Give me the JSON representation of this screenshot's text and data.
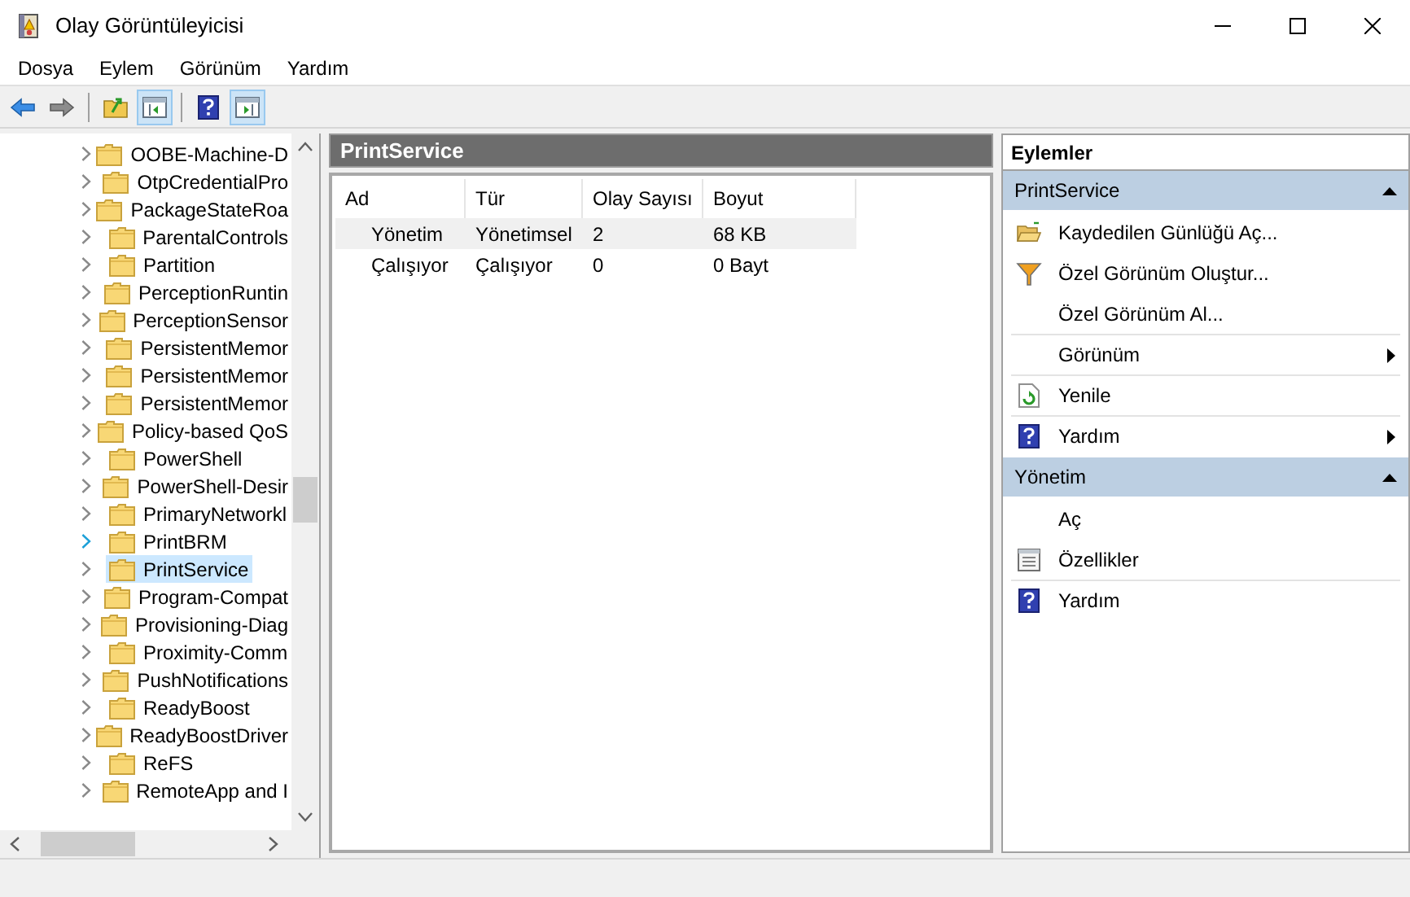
{
  "window": {
    "title": "Olay Görüntüleyicisi"
  },
  "menu": [
    "Dosya",
    "Eylem",
    "Görünüm",
    "Yardım"
  ],
  "toolbar": [
    {
      "kind": "back",
      "pressed": false
    },
    {
      "kind": "forward",
      "pressed": false
    },
    {
      "kind": "separator"
    },
    {
      "kind": "up",
      "pressed": false
    },
    {
      "kind": "console-tree",
      "pressed": true
    },
    {
      "kind": "separator"
    },
    {
      "kind": "help",
      "pressed": false
    },
    {
      "kind": "action-pane",
      "pressed": true
    }
  ],
  "tree": {
    "items": [
      {
        "label": "OOBE-Machine-D",
        "selected": false,
        "hovered": false
      },
      {
        "label": "OtpCredentialPro",
        "selected": false,
        "hovered": false
      },
      {
        "label": "PackageStateRoa",
        "selected": false,
        "hovered": false
      },
      {
        "label": "ParentalControls",
        "selected": false,
        "hovered": false
      },
      {
        "label": "Partition",
        "selected": false,
        "hovered": false
      },
      {
        "label": "PerceptionRuntin",
        "selected": false,
        "hovered": false
      },
      {
        "label": "PerceptionSensor",
        "selected": false,
        "hovered": false
      },
      {
        "label": "PersistentMemor",
        "selected": false,
        "hovered": false
      },
      {
        "label": "PersistentMemor",
        "selected": false,
        "hovered": false
      },
      {
        "label": "PersistentMemor",
        "selected": false,
        "hovered": false
      },
      {
        "label": "Policy-based QoS",
        "selected": false,
        "hovered": false
      },
      {
        "label": "PowerShell",
        "selected": false,
        "hovered": false
      },
      {
        "label": "PowerShell-Desir",
        "selected": false,
        "hovered": false
      },
      {
        "label": "PrimaryNetworkl",
        "selected": false,
        "hovered": false
      },
      {
        "label": "PrintBRM",
        "selected": false,
        "hovered": true
      },
      {
        "label": "PrintService",
        "selected": true,
        "hovered": false
      },
      {
        "label": "Program-Compat",
        "selected": false,
        "hovered": false
      },
      {
        "label": "Provisioning-Diag",
        "selected": false,
        "hovered": false
      },
      {
        "label": "Proximity-Comm",
        "selected": false,
        "hovered": false
      },
      {
        "label": "PushNotifications",
        "selected": false,
        "hovered": false
      },
      {
        "label": "ReadyBoost",
        "selected": false,
        "hovered": false
      },
      {
        "label": "ReadyBoostDriver",
        "selected": false,
        "hovered": false
      },
      {
        "label": "ReFS",
        "selected": false,
        "hovered": false
      },
      {
        "label": "RemoteApp and I",
        "selected": false,
        "hovered": false
      }
    ]
  },
  "center": {
    "title": "PrintService",
    "table": {
      "columns": [
        "Ad",
        "Tür",
        "Olay Sayısı",
        "Boyut"
      ],
      "rows": [
        {
          "cells": [
            "Yönetim",
            "Yönetimsel",
            "2",
            "68 KB"
          ],
          "selected": true
        },
        {
          "cells": [
            "Çalışıyor",
            "Çalışıyor",
            "0",
            "0 Bayt"
          ],
          "selected": false
        }
      ]
    }
  },
  "actions": {
    "title": "Eylemler",
    "groups": [
      {
        "title": "PrintService",
        "expanded": true,
        "items": [
          {
            "label": "Kaydedilen Günlüğü Aç...",
            "kind": "open-folder",
            "submenu": false,
            "separated": false
          },
          {
            "label": "Özel Görünüm Oluştur...",
            "kind": "filter",
            "submenu": false,
            "separated": false
          },
          {
            "label": "Özel Görünüm Al...",
            "kind": "none",
            "submenu": false,
            "separated": false
          },
          {
            "label": "Görünüm",
            "kind": "none",
            "submenu": true,
            "separated": true
          },
          {
            "label": "Yenile",
            "kind": "refresh",
            "submenu": false,
            "separated": true
          },
          {
            "label": "Yardım",
            "kind": "help",
            "submenu": true,
            "separated": true
          }
        ]
      },
      {
        "title": "Yönetim",
        "expanded": true,
        "items": [
          {
            "label": "Aç",
            "kind": "none",
            "submenu": false,
            "separated": false
          },
          {
            "label": "Özellikler",
            "kind": "properties",
            "submenu": false,
            "separated": false
          },
          {
            "label": "Yardım",
            "kind": "help",
            "submenu": false,
            "separated": true
          }
        ]
      }
    ]
  }
}
